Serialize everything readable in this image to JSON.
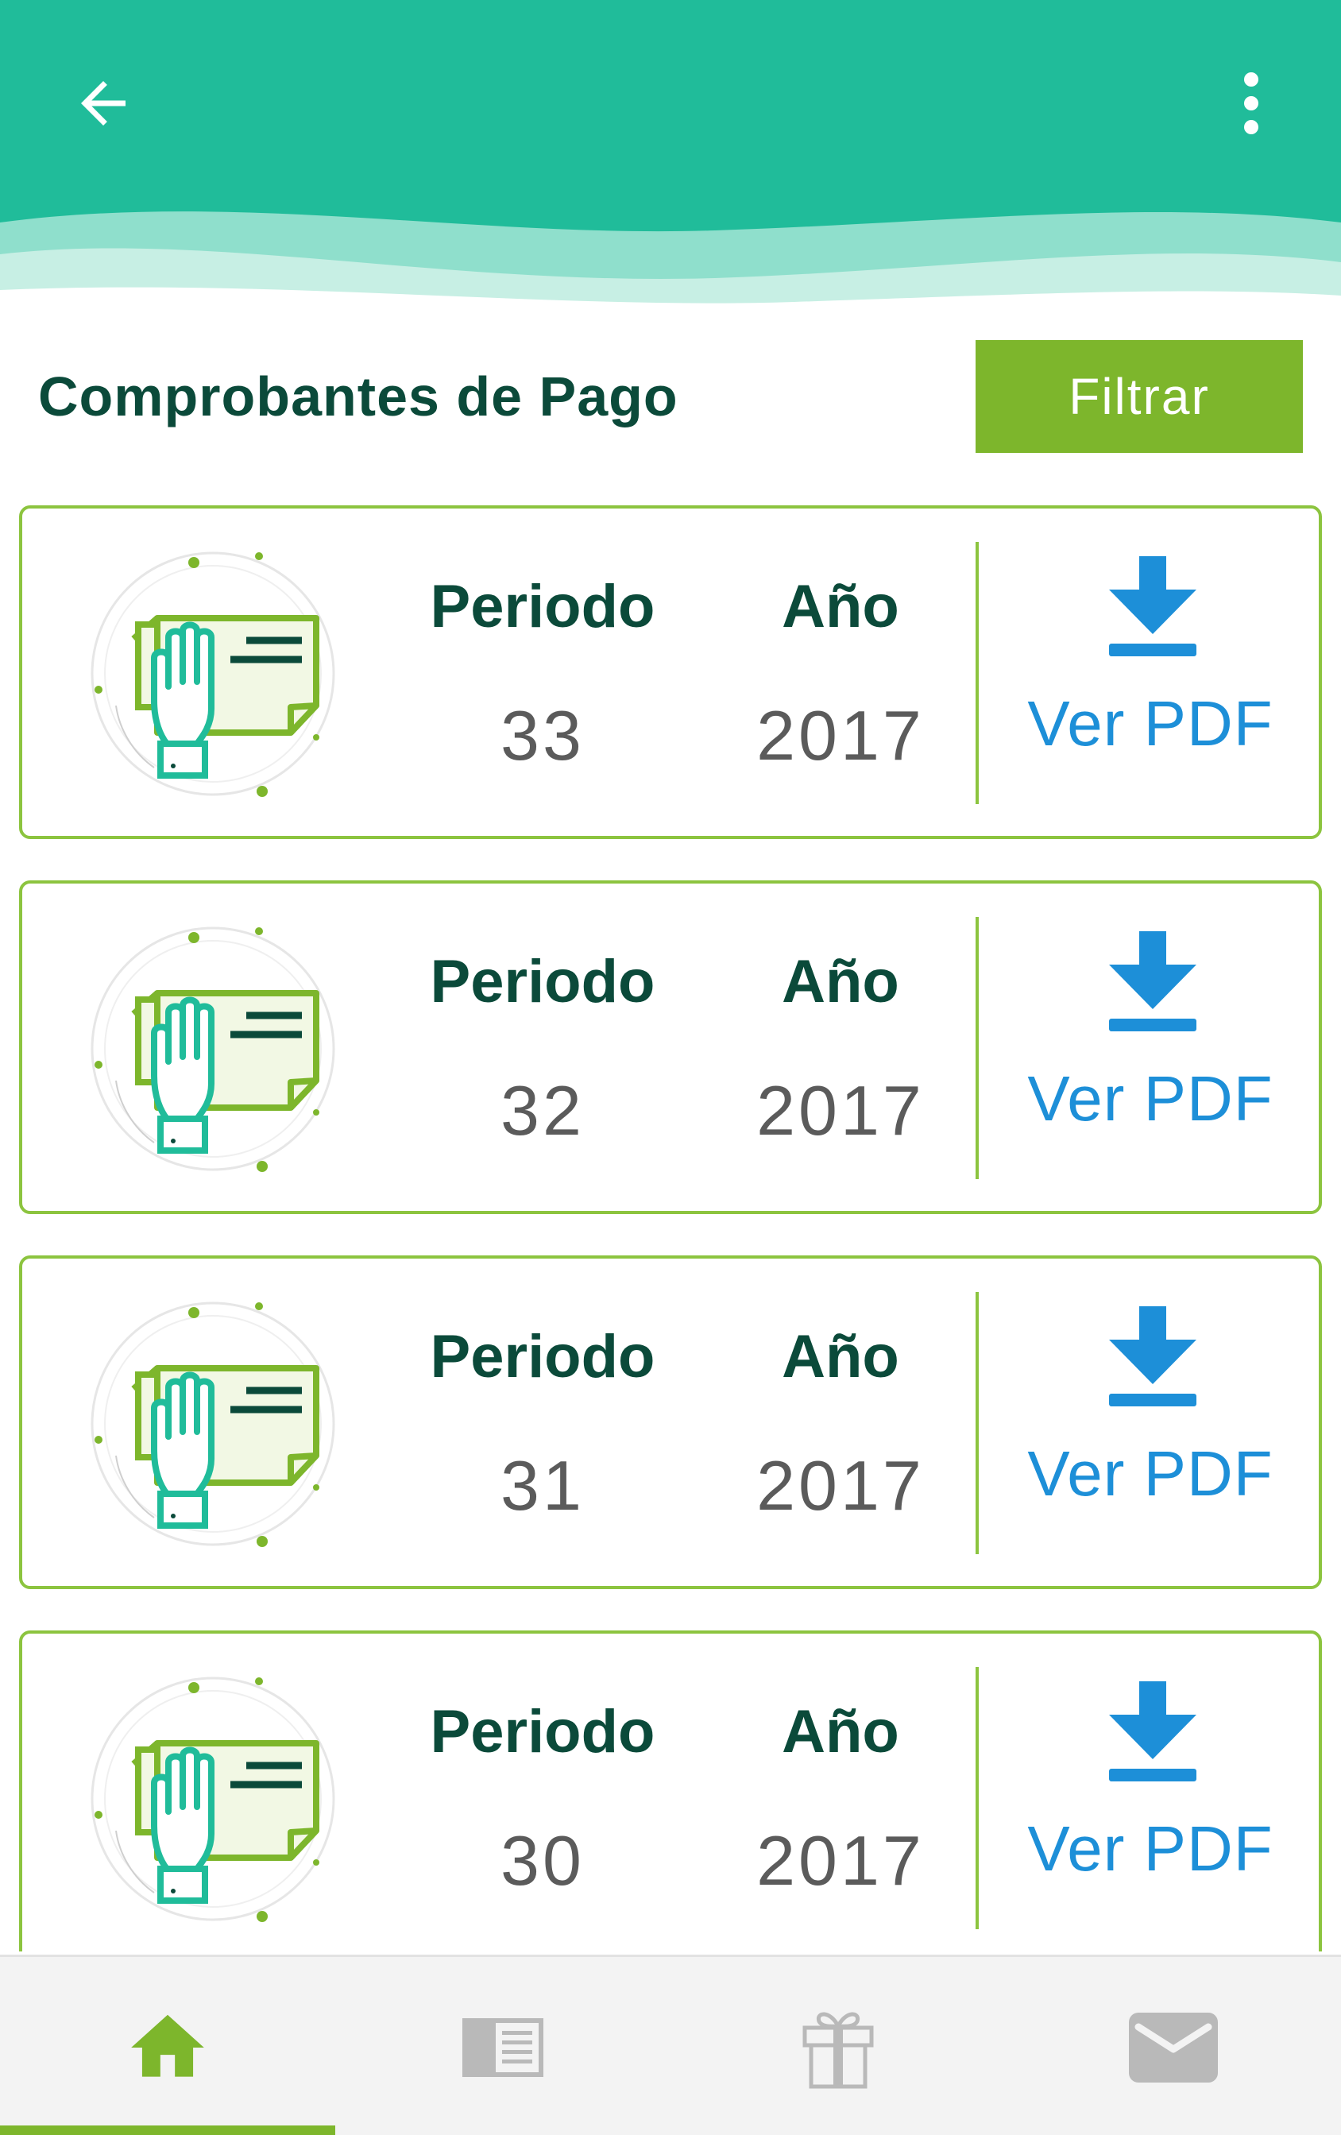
{
  "header": {
    "back_icon": "arrow-left-icon",
    "menu_icon": "more-vertical-icon",
    "background_color": "#20bc9a"
  },
  "page": {
    "title": "Comprobantes de Pago",
    "filter_label": "Filtrar",
    "filter_color": "#7db62c"
  },
  "receipts": [
    {
      "periodo_label": "Periodo",
      "anio_label": "Año",
      "periodo": "33",
      "anio": "2017",
      "action_label": "Ver PDF"
    },
    {
      "periodo_label": "Periodo",
      "anio_label": "Año",
      "periodo": "32",
      "anio": "2017",
      "action_label": "Ver PDF"
    },
    {
      "periodo_label": "Periodo",
      "anio_label": "Año",
      "periodo": "31",
      "anio": "2017",
      "action_label": "Ver PDF"
    },
    {
      "periodo_label": "Periodo",
      "anio_label": "Año",
      "periodo": "30",
      "anio": "2017",
      "action_label": "Ver PDF"
    }
  ],
  "bottom_nav": {
    "items": [
      {
        "icon": "home-icon",
        "active": true
      },
      {
        "icon": "newspaper-icon",
        "active": false
      },
      {
        "icon": "gift-icon",
        "active": false
      },
      {
        "icon": "mail-icon",
        "active": false
      }
    ],
    "active_color": "#7db62c",
    "inactive_color": "#b9b9b9"
  }
}
